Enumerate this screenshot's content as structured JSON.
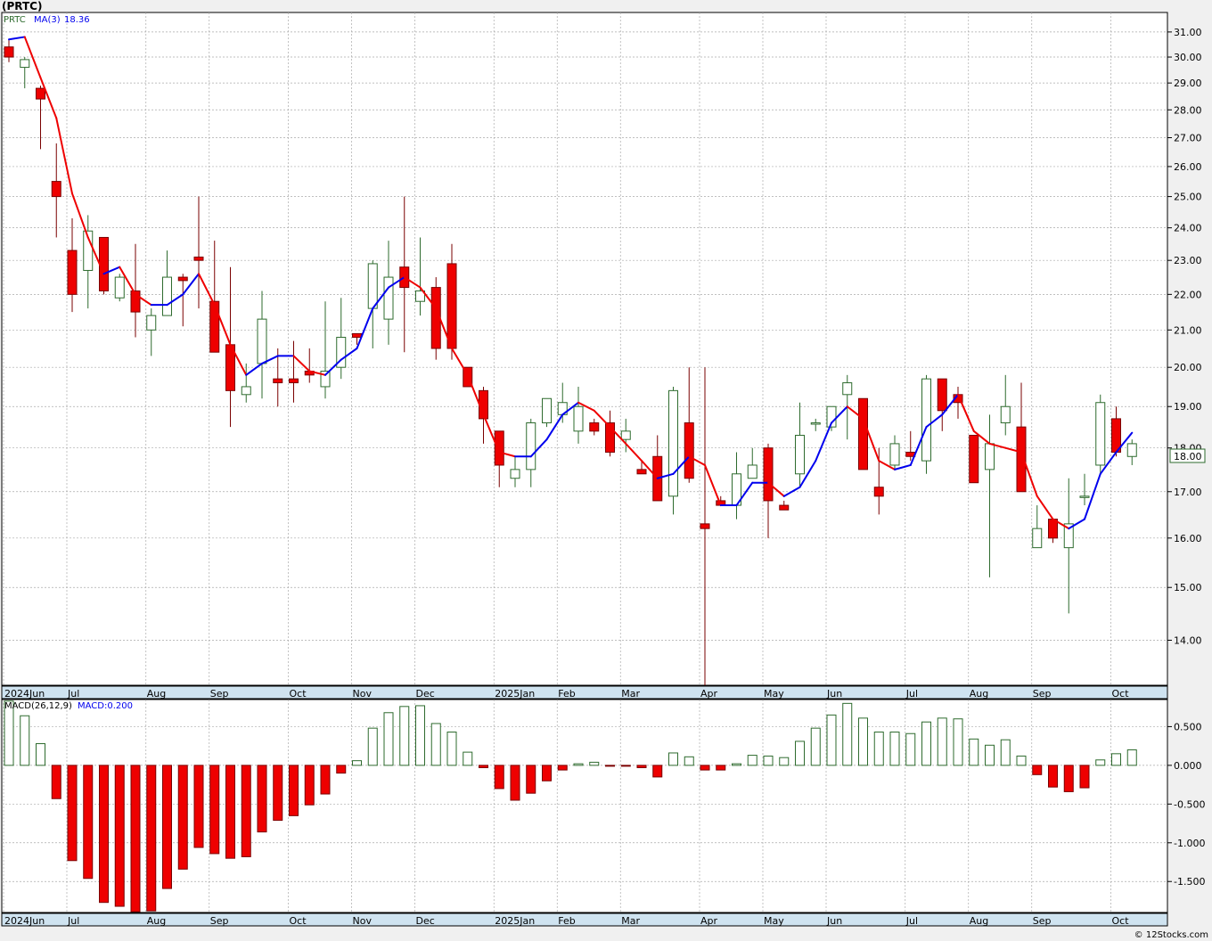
{
  "header": {
    "title": "(PRTC)",
    "legend_symbol": "PRTC",
    "legend_ma": "MA(3)",
    "legend_ma_value": "18.36",
    "last_price_tag": "18.00",
    "macd_label": "MACD(26,12,9)",
    "macd_value_label": "MACD:0.200",
    "watermark": "© 12Stocks.com"
  },
  "colors": {
    "up_candle": "#2e6b2e",
    "down_candle": "#ee0000",
    "ma_up": "#0000ee",
    "ma_down": "#ee0000",
    "grid": "#aaaaaa",
    "axis_band": "#cfe3f0"
  },
  "chart_data": [
    {
      "type": "candlestick",
      "symbol": "PRTC",
      "yscale": "log",
      "ylim": [
        13.2,
        31.8
      ],
      "y_ticks": [
        14,
        15,
        16,
        17,
        18,
        19,
        20,
        21,
        22,
        23,
        24,
        25,
        26,
        27,
        28,
        29,
        30,
        31
      ],
      "y_tick_labels": [
        "14.00",
        "15.00",
        "16.00",
        "17.00",
        "18.00",
        "19.00",
        "20.00",
        "21.00",
        "22.00",
        "23.00",
        "24.00",
        "25.00",
        "26.00",
        "27.00",
        "28.00",
        "29.00",
        "30.00",
        "31.00"
      ],
      "x_labels": [
        "2024Jun",
        "Jul",
        "Aug",
        "Sep",
        "Oct",
        "Nov",
        "Dec",
        "2025Jan",
        "Feb",
        "Mar",
        "Apr",
        "May",
        "Jun",
        "Jul",
        "Aug",
        "Sep",
        "Oct"
      ],
      "x_label_week_index": [
        0,
        4,
        9,
        13,
        18,
        22,
        26,
        31,
        35,
        39,
        44,
        48,
        52,
        57,
        61,
        65,
        70
      ],
      "series": [
        {
          "ohlc": [
            [
              30.4,
              30.7,
              29.8,
              30.0
            ],
            [
              29.6,
              30.0,
              28.8,
              29.9
            ],
            [
              28.8,
              28.9,
              26.6,
              28.4
            ],
            [
              25.5,
              26.8,
              23.7,
              25.0
            ],
            [
              23.3,
              24.3,
              21.5,
              22.0
            ],
            [
              22.7,
              24.4,
              21.6,
              23.9
            ],
            [
              23.7,
              23.7,
              22.0,
              22.1
            ],
            [
              21.9,
              22.6,
              21.8,
              22.5
            ],
            [
              22.1,
              23.5,
              20.8,
              21.5
            ],
            [
              21.0,
              21.6,
              20.3,
              21.4
            ],
            [
              21.4,
              23.3,
              21.4,
              22.5
            ],
            [
              22.5,
              22.6,
              21.1,
              22.4
            ],
            [
              23.1,
              25.0,
              21.6,
              23.0
            ],
            [
              21.8,
              23.6,
              20.4,
              20.4
            ],
            [
              20.6,
              22.8,
              18.5,
              19.4
            ],
            [
              19.3,
              20.1,
              19.1,
              19.5
            ],
            [
              20.1,
              22.1,
              19.2,
              21.3
            ],
            [
              19.7,
              20.5,
              19.0,
              19.6
            ],
            [
              19.7,
              20.7,
              19.1,
              19.6
            ],
            [
              19.9,
              20.5,
              19.6,
              19.8
            ],
            [
              19.5,
              21.8,
              19.2,
              19.9
            ],
            [
              20.0,
              21.9,
              19.7,
              20.8
            ],
            [
              20.9,
              20.9,
              20.6,
              20.8
            ],
            [
              21.6,
              23.0,
              20.5,
              22.9
            ],
            [
              21.3,
              23.6,
              20.6,
              22.5
            ],
            [
              22.8,
              25.0,
              20.4,
              22.2
            ],
            [
              21.8,
              23.7,
              21.4,
              22.1
            ],
            [
              22.2,
              22.5,
              20.2,
              20.5
            ],
            [
              22.9,
              23.5,
              20.2,
              20.5
            ],
            [
              20.0,
              20.0,
              19.5,
              19.5
            ],
            [
              19.4,
              19.5,
              18.1,
              18.7
            ],
            [
              18.4,
              18.4,
              17.1,
              17.6
            ],
            [
              17.3,
              17.8,
              17.1,
              17.5
            ],
            [
              17.5,
              18.7,
              17.1,
              18.6
            ],
            [
              18.6,
              19.2,
              18.5,
              19.2
            ],
            [
              18.8,
              19.6,
              18.6,
              19.1
            ],
            [
              18.4,
              19.5,
              18.1,
              19.0
            ],
            [
              18.6,
              18.7,
              18.3,
              18.4
            ],
            [
              18.6,
              18.9,
              17.8,
              17.9
            ],
            [
              18.2,
              18.7,
              17.9,
              18.4
            ],
            [
              17.5,
              17.7,
              17.5,
              17.4
            ],
            [
              17.8,
              18.3,
              16.8,
              16.8
            ],
            [
              16.9,
              19.5,
              16.5,
              19.4
            ],
            [
              18.6,
              20.0,
              17.2,
              17.3
            ],
            [
              16.3,
              20.0,
              13.2,
              16.2
            ],
            [
              16.8,
              16.9,
              16.7,
              16.7
            ],
            [
              16.7,
              17.9,
              16.4,
              17.4
            ],
            [
              17.3,
              18.0,
              17.3,
              17.6
            ],
            [
              18.0,
              18.1,
              16.0,
              16.8
            ],
            [
              16.7,
              16.8,
              16.6,
              16.6
            ],
            [
              17.4,
              19.1,
              17.1,
              18.3
            ],
            [
              18.6,
              18.7,
              18.4,
              18.6
            ],
            [
              18.5,
              19.0,
              18.4,
              19.0
            ],
            [
              19.3,
              19.8,
              18.2,
              19.6
            ],
            [
              19.2,
              19.2,
              17.5,
              17.5
            ],
            [
              17.1,
              18.0,
              16.5,
              16.9
            ],
            [
              17.6,
              18.3,
              17.5,
              18.1
            ],
            [
              17.9,
              18.4,
              17.7,
              17.8
            ],
            [
              17.7,
              19.8,
              17.4,
              19.7
            ],
            [
              19.7,
              19.7,
              18.4,
              18.9
            ],
            [
              19.3,
              19.5,
              18.7,
              19.1
            ],
            [
              18.3,
              18.3,
              17.2,
              17.2
            ],
            [
              17.5,
              18.8,
              15.2,
              18.1
            ],
            [
              18.6,
              19.8,
              18.3,
              19.0
            ],
            [
              18.5,
              19.6,
              17.0,
              17.0
            ],
            [
              15.8,
              16.7,
              15.8,
              16.2
            ],
            [
              16.4,
              16.4,
              15.9,
              16.0
            ],
            [
              15.8,
              17.3,
              14.5,
              16.3
            ],
            [
              16.9,
              17.4,
              16.7,
              16.9
            ],
            [
              17.6,
              19.3,
              17.4,
              19.1
            ],
            [
              18.7,
              19.0,
              17.8,
              17.9
            ],
            [
              17.8,
              18.2,
              17.6,
              18.1
            ]
          ],
          "ma": [
            30.7,
            30.8,
            29.2,
            27.7,
            25.1,
            23.7,
            22.6,
            22.8,
            22.0,
            21.7,
            21.7,
            22.0,
            22.6,
            21.7,
            20.6,
            19.8,
            20.1,
            20.3,
            20.3,
            19.9,
            19.8,
            20.2,
            20.5,
            21.6,
            22.2,
            22.5,
            22.2,
            21.6,
            20.5,
            19.8,
            18.8,
            17.9,
            17.8,
            17.8,
            18.2,
            18.8,
            19.1,
            18.9,
            18.5,
            18.1,
            17.7,
            17.3,
            17.4,
            17.8,
            17.6,
            16.7,
            16.7,
            17.2,
            17.2,
            16.9,
            17.1,
            17.7,
            18.6,
            19.0,
            18.7,
            17.7,
            17.5,
            17.6,
            18.5,
            18.8,
            19.3,
            18.4,
            18.1,
            18.0,
            17.9,
            16.9,
            16.4,
            16.2,
            16.4,
            17.4,
            17.9,
            18.36
          ]
        }
      ]
    },
    {
      "type": "bar",
      "name": "MACD(26,12,9)",
      "ylim": [
        -1.9,
        0.85
      ],
      "y_ticks": [
        -1.5,
        -1.0,
        -0.5,
        0.0,
        0.5
      ],
      "y_tick_labels": [
        "-1.500",
        "-1.000",
        "-0.500",
        "0.000",
        "0.500"
      ],
      "values": [
        0.83,
        0.64,
        0.28,
        -0.43,
        -1.23,
        -1.46,
        -1.77,
        -1.82,
        -1.89,
        -1.88,
        -1.59,
        -1.34,
        -1.06,
        -1.14,
        -1.2,
        -1.18,
        -0.86,
        -0.71,
        -0.65,
        -0.51,
        -0.37,
        -0.1,
        0.06,
        0.48,
        0.68,
        0.76,
        0.77,
        0.54,
        0.43,
        0.17,
        -0.03,
        -0.3,
        -0.45,
        -0.36,
        -0.2,
        -0.06,
        0.02,
        0.04,
        -0.01,
        -0.01,
        -0.03,
        -0.15,
        0.16,
        0.11,
        -0.06,
        -0.06,
        0.02,
        0.13,
        0.12,
        0.1,
        0.31,
        0.48,
        0.65,
        0.8,
        0.61,
        0.43,
        0.43,
        0.41,
        0.56,
        0.61,
        0.6,
        0.34,
        0.26,
        0.33,
        0.12,
        -0.12,
        -0.28,
        -0.34,
        -0.29,
        0.07,
        0.15,
        0.2
      ]
    }
  ]
}
